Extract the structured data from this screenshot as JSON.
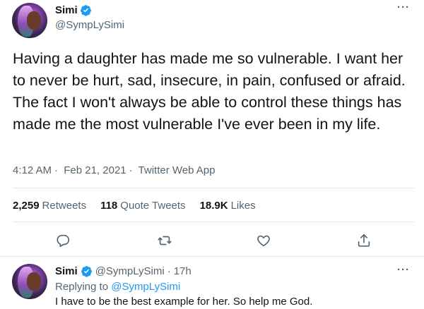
{
  "tweet": {
    "author_name": "Simi",
    "author_handle": "@SympLySimi",
    "more": "···",
    "text": "Having a daughter has made me so vulnerable. I want her to never be hurt, sad, insecure, in pain, confused or afraid. The fact I won't  always be able to control these things has made me the most vulnerable I've ever been in my life.",
    "time": "4:12 AM",
    "date": "Feb 21, 2021",
    "source": "Twitter Web App",
    "separator": "·",
    "stats": [
      {
        "num": "2,259",
        "label": "Retweets"
      },
      {
        "num": "118",
        "label": "Quote Tweets"
      },
      {
        "num": "18.9K",
        "label": "Likes"
      }
    ],
    "actions": [
      "reply-icon",
      "retweet-icon",
      "like-icon",
      "share-icon"
    ]
  },
  "reply": {
    "author_name": "Simi",
    "author_handle": "@SympLySimi",
    "separator": "·",
    "age": "17h",
    "replying_prefix": "Replying to",
    "replying_to": "@SympLySimi",
    "text": "I have to be the best example for her. So help me God.",
    "more": "···"
  },
  "colors": {
    "text": "#0f1419",
    "secondary": "#536471",
    "accent": "#1d9bf0",
    "divider": "#e1e8ed"
  }
}
